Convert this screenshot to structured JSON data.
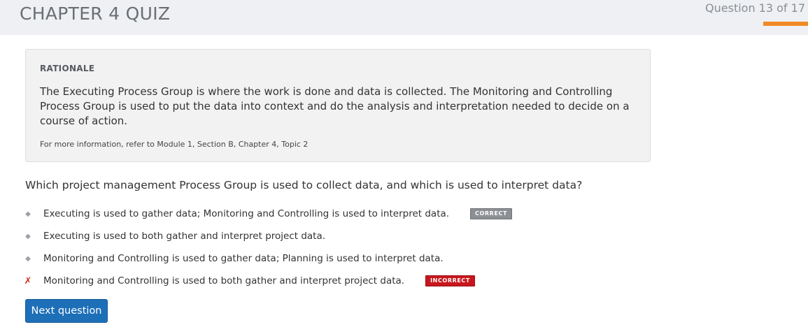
{
  "header": {
    "title": "CHAPTER 4 QUIZ",
    "progress_text": "Question 13 of 17",
    "progress": {
      "current": 13,
      "total": 17
    },
    "accent_color": "#f08a24"
  },
  "rationale": {
    "heading": "RATIONALE",
    "body": "The Executing Process Group is where the work is done and data is collected. The Monitoring and Controlling Process Group is used to put the data into context and do the analysis and interpretation needed to decide on a course of action.",
    "reference": "For more information, refer to Module 1, Section B, Chapter 4, Topic 2"
  },
  "question": {
    "text": "Which project management Process Group is used to collect data, and which is used to interpret data?",
    "answers": [
      {
        "label": "Executing is used to gather data; Monitoring and Controlling is used to interpret data.",
        "marker": "diamond-icon",
        "badge": "CORRECT"
      },
      {
        "label": "Executing is used to both gather and interpret project data.",
        "marker": "diamond-icon",
        "badge": ""
      },
      {
        "label": "Monitoring and Controlling is used to gather data; Planning is used to interpret data.",
        "marker": "diamond-icon",
        "badge": ""
      },
      {
        "label": "Monitoring and Controlling is used to both gather and interpret project data.",
        "marker": "x-mark-icon",
        "badge": "INCORRECT"
      }
    ]
  },
  "colors": {
    "correct_badge": "#8c8f93",
    "incorrect_badge": "#c8161d",
    "incorrect_mark": "#d42a1e",
    "button": "#1d6fb8"
  },
  "actions": {
    "next_label": "Next question"
  }
}
